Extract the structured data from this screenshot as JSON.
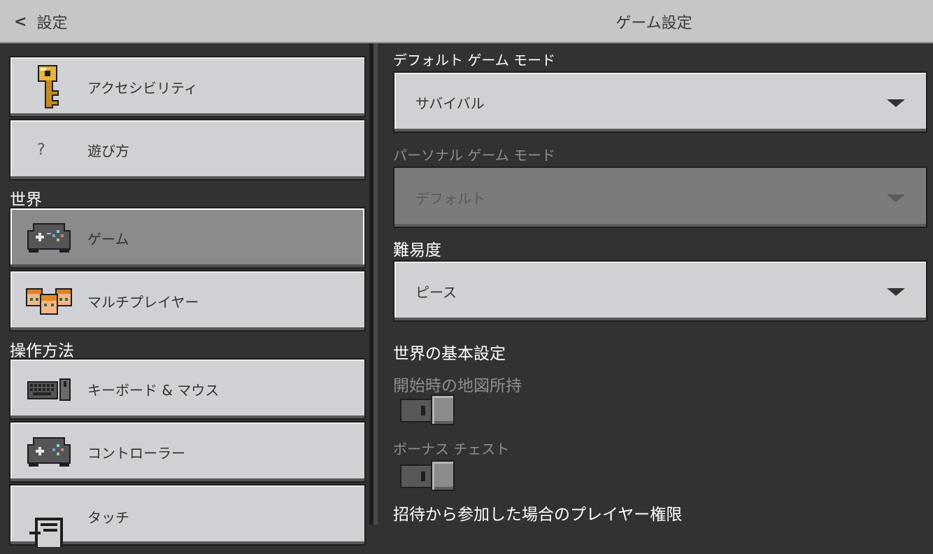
{
  "header": {
    "back_label": "設定",
    "title": "ゲーム設定"
  },
  "sidebar": {
    "items": [
      {
        "label": "アクセシビリティ",
        "icon": "key-icon"
      },
      {
        "label": "遊び方",
        "icon": "question-icon",
        "glyph": "?"
      },
      {
        "label": "ゲーム",
        "icon": "gamepad-icon",
        "selected": true
      },
      {
        "label": "マルチプレイヤー",
        "icon": "players-icon"
      },
      {
        "label": "キーボード & マウス",
        "icon": "keyboard-mouse-icon"
      },
      {
        "label": "コントローラー",
        "icon": "controller-icon"
      },
      {
        "label": "タッチ",
        "icon": "touch-icon"
      }
    ],
    "sections": {
      "world": "世界",
      "controls": "操作方法"
    }
  },
  "main": {
    "default_game_mode": {
      "label": "デフォルト ゲーム モード",
      "value": "サバイバル"
    },
    "personal_game_mode": {
      "label": "パーソナル ゲーム モード",
      "value": "デフォルト"
    },
    "difficulty": {
      "label": "難易度",
      "value": "ピース"
    },
    "world_basics_heading": "世界の基本設定",
    "starting_map": {
      "label": "開始時の地図所持",
      "on": false
    },
    "bonus_chest": {
      "label": "ボーナス チェスト",
      "on": false
    },
    "invite_permissions_heading": "招待から参加した場合のプレイヤー権限"
  },
  "colors": {
    "background": "#313233",
    "button": "#d0d1d4",
    "selected": "#8b8b8b",
    "header": "#c6c6c6"
  }
}
